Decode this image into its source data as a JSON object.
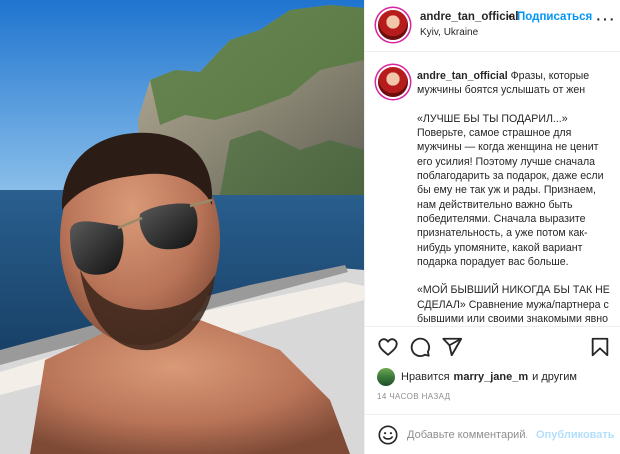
{
  "header": {
    "username": "andre_tan_official",
    "dot": "•",
    "follow_label": "Подписаться",
    "location": "Kyiv, Ukraine",
    "more_icon": "more-horizontal-icon"
  },
  "caption": {
    "username": "andre_tan_official",
    "intro": "Фразы, которые мужчины боятся услышать от жен",
    "p1": "«ЛУЧШЕ БЫ ТЫ ПОДАРИЛ...» Поверьте, самое страшное для мужчины — когда женщина не ценит его усилия! Поэтому лучше сначала поблагодарить за подарок, даже если бы ему не так уж и рады. Признаем, нам действительно важно быть победителями. Сначала выразите признательность, а уже потом как-нибудь упомяните, какой вариант подарка порадует вас больше.",
    "p2": "«МОЙ БЫВШИЙ НИКОГДА БЫ ТАК НЕ СДЕЛАЛ» Сравнение мужа/партнера с бывшими или своими знакомыми явно не"
  },
  "actions": {
    "like_icon": "heart-icon",
    "comment_icon": "comment-icon",
    "share_icon": "paper-plane-icon",
    "save_icon": "bookmark-icon"
  },
  "likes": {
    "prefix": "Нравится",
    "user": "marry_jane_m",
    "suffix": "и другим"
  },
  "timestamp": "14 ЧАСОВ НАЗАД",
  "comment": {
    "placeholder": "Добавьте комментарий...",
    "post_label": "Опубликовать",
    "emoji_icon": "smiley-icon"
  },
  "colors": {
    "accent": "#0095f6",
    "post_disabled": "#b2dffc",
    "text": "#262626",
    "muted": "#8e8e8e",
    "divider": "#efefef"
  }
}
